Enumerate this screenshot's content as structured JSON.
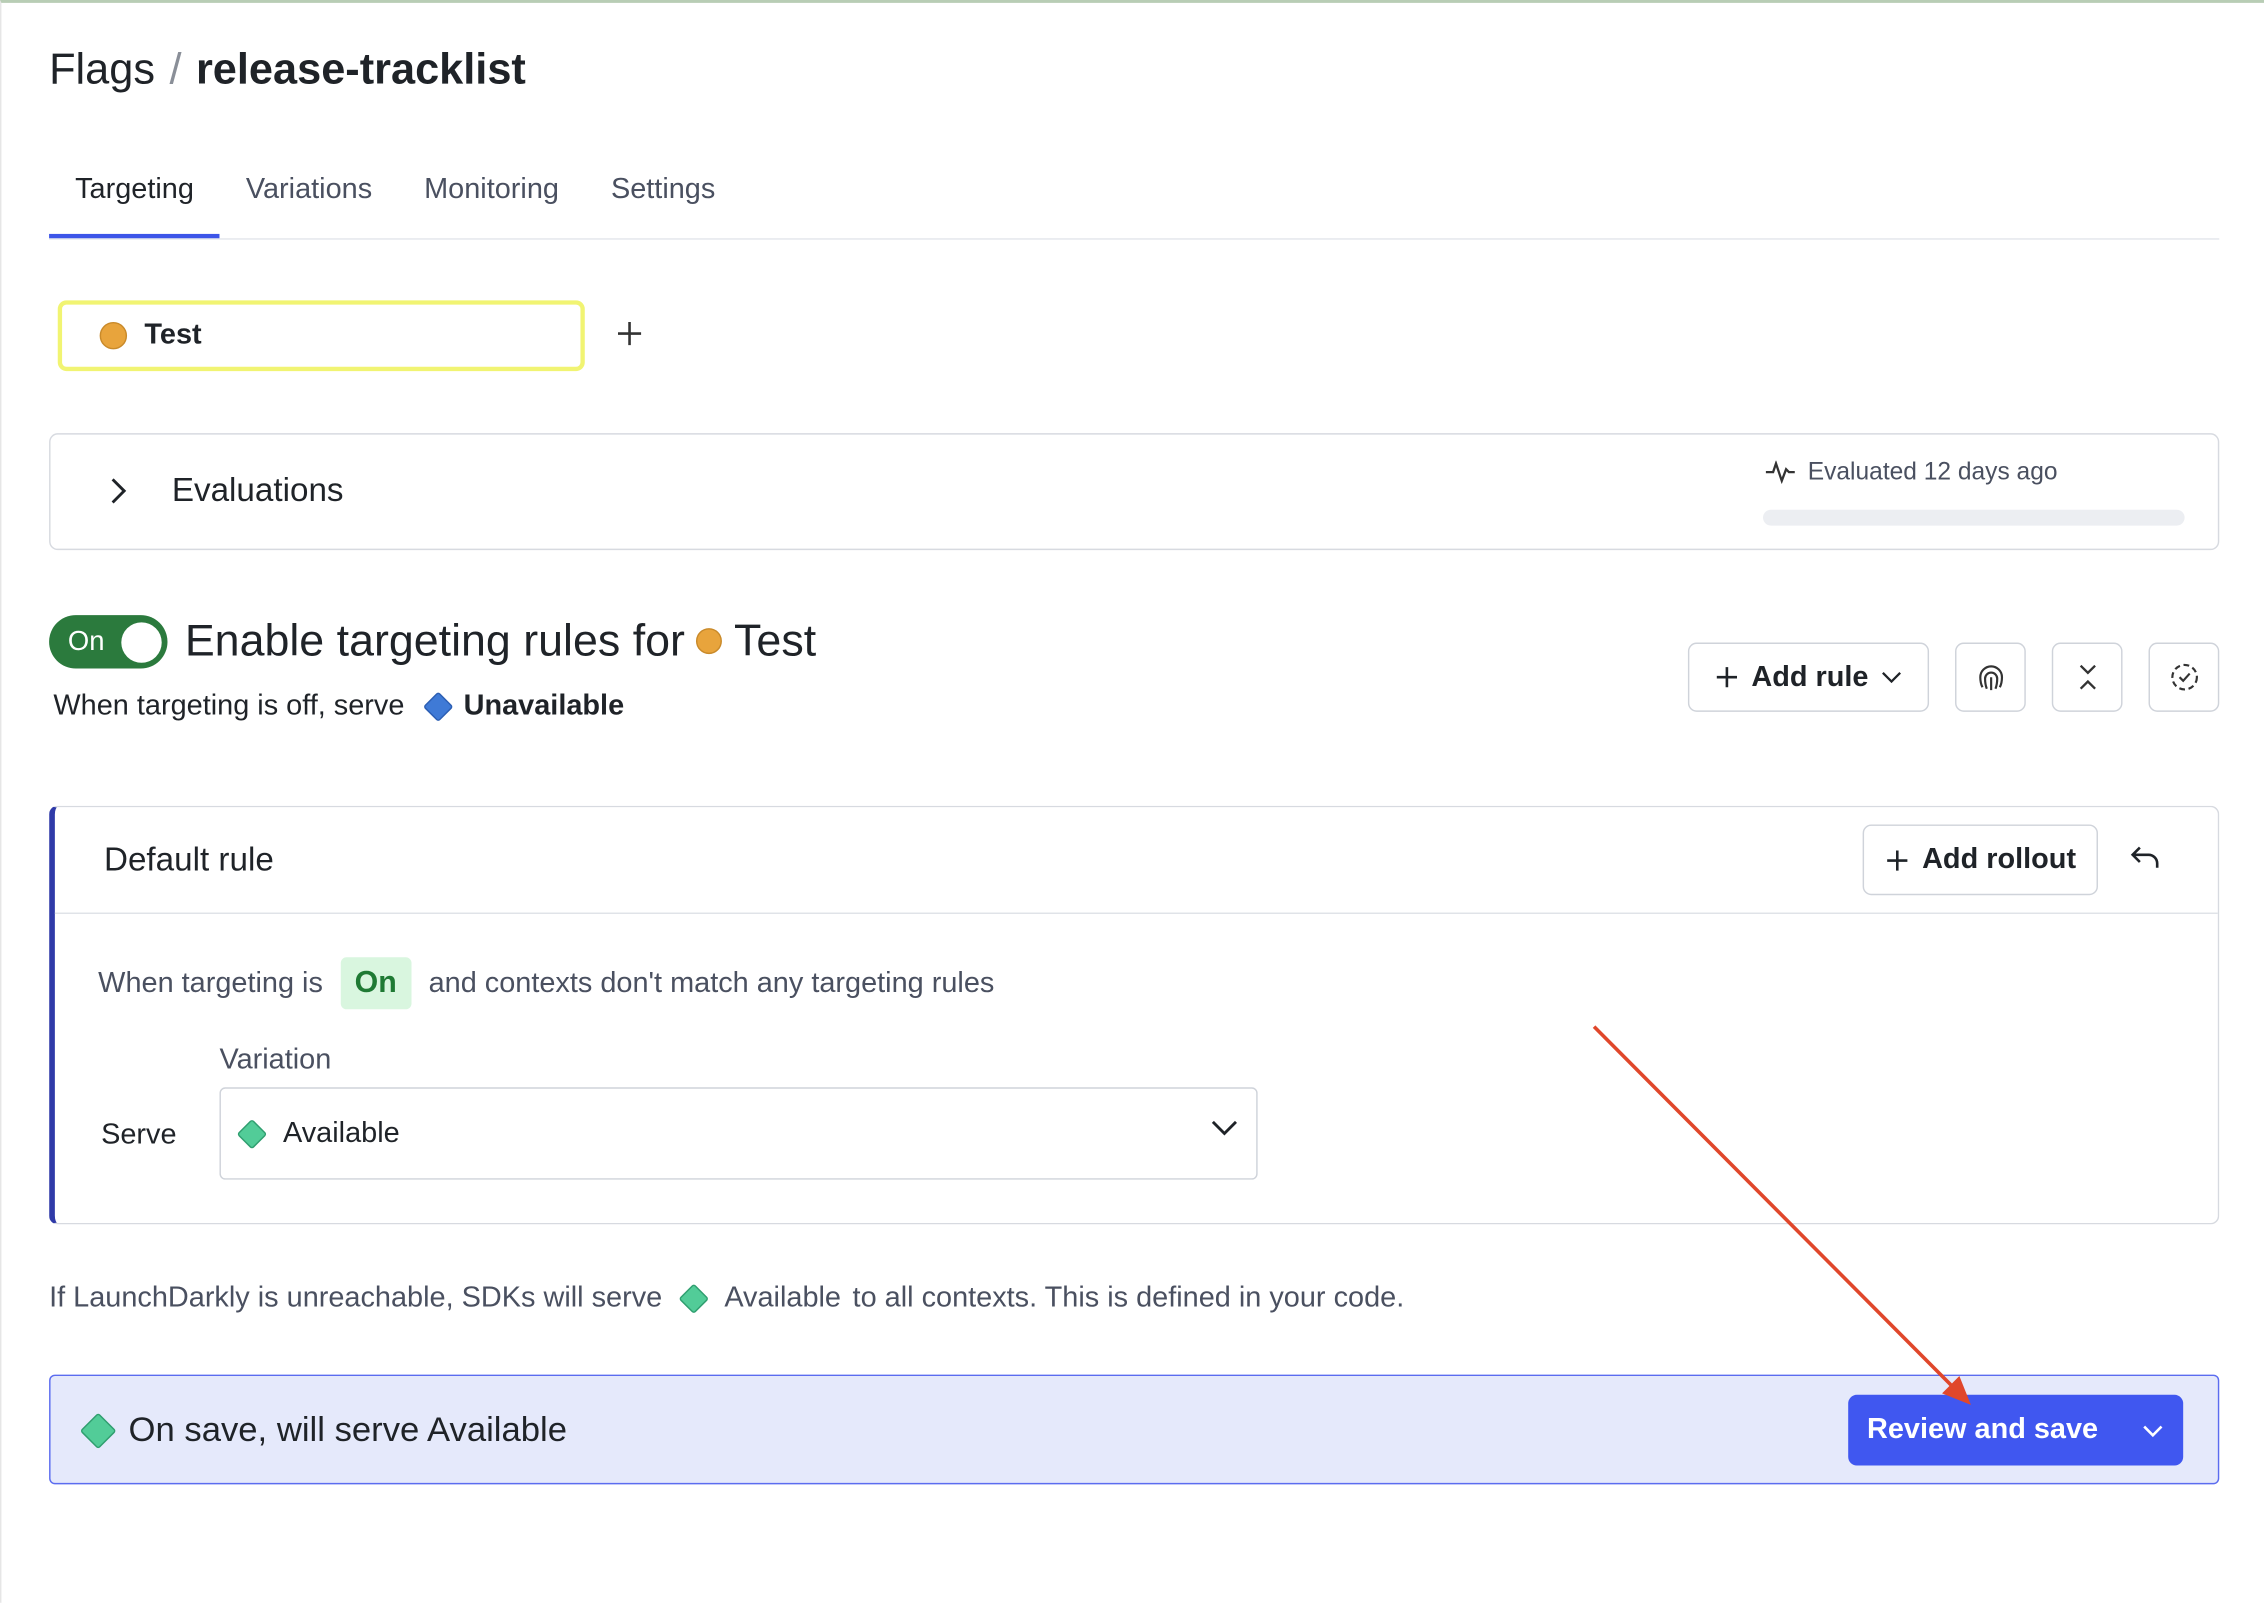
{
  "breadcrumb": {
    "root": "Flags",
    "separator": "/",
    "leaf": "release-tracklist"
  },
  "tabs": [
    {
      "label": "Targeting",
      "active": true
    },
    {
      "label": "Variations",
      "active": false
    },
    {
      "label": "Monitoring",
      "active": false
    },
    {
      "label": "Settings",
      "active": false
    }
  ],
  "environment": {
    "name": "Test",
    "color": "#e8a43c"
  },
  "evaluations": {
    "title": "Evaluations",
    "meta": "Evaluated 12 days ago"
  },
  "targeting": {
    "toggle_label": "On",
    "title_prefix": "Enable targeting rules for",
    "env_name": "Test",
    "off_serve_prefix": "When targeting is off, serve",
    "off_serve_value": "Unavailable",
    "add_rule_label": "Add rule"
  },
  "default_rule": {
    "title": "Default rule",
    "add_rollout_label": "Add rollout",
    "line_prefix": "When targeting is",
    "line_pill": "On",
    "line_suffix": "and contexts don't match any targeting rules",
    "variation_label": "Variation",
    "serve_label": "Serve",
    "selected_variation": "Available"
  },
  "fallback": {
    "prefix": "If LaunchDarkly is unreachable, SDKs will serve",
    "value": "Available",
    "suffix": "to all contexts. This is defined in your code."
  },
  "save_bar": {
    "message": "On save, will serve Available",
    "button_label": "Review and save"
  },
  "colors": {
    "accent": "#4057f0",
    "toggle_on": "#2b7a3d",
    "available": "#52cc98",
    "unavailable": "#3f7ad6",
    "env_highlight": "#f1f472",
    "annotation_arrow": "#e0472b"
  }
}
